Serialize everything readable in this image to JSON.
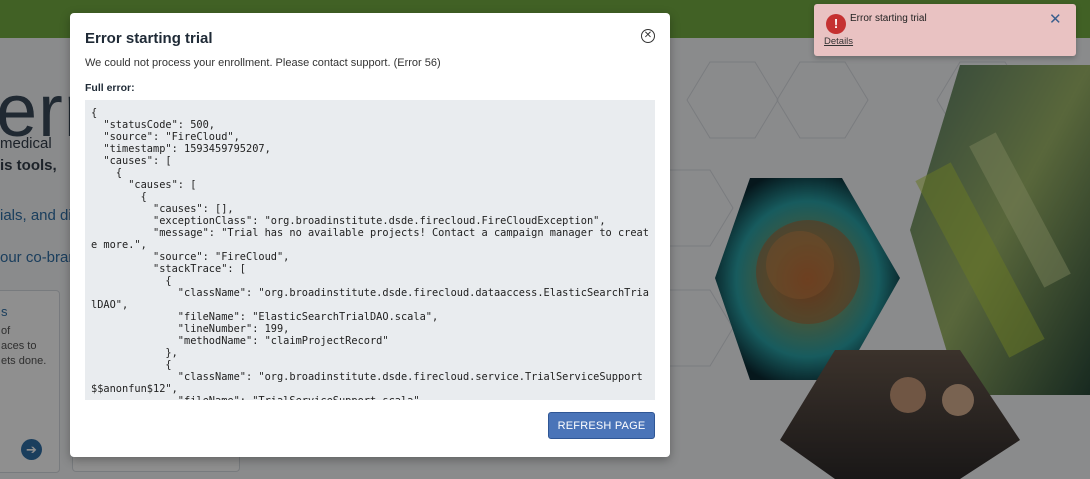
{
  "background": {
    "hero_title": "erra",
    "hero_lines": [
      "medical",
      "is tools,",
      "ials, and di",
      "our co-bran"
    ],
    "card": {
      "title": "s",
      "description": "of\naces to\nets done."
    }
  },
  "modal": {
    "title": "Error starting trial",
    "message": "We could not process your enrollment. Please contact support. (Error 56)",
    "full_error_label": "Full error:",
    "full_error_text": "{\n  \"statusCode\": 500,\n  \"source\": \"FireCloud\",\n  \"timestamp\": 1593459795207,\n  \"causes\": [\n    {\n      \"causes\": [\n        {\n          \"causes\": [],\n          \"exceptionClass\": \"org.broadinstitute.dsde.firecloud.FireCloudException\",\n          \"message\": \"Trial has no available projects! Contact a campaign manager to create more.\",\n          \"source\": \"FireCloud\",\n          \"stackTrace\": [\n            {\n              \"className\": \"org.broadinstitute.dsde.firecloud.dataaccess.ElasticSearchTrialDAO\",\n              \"fileName\": \"ElasticSearchTrialDAO.scala\",\n              \"lineNumber\": 199,\n              \"methodName\": \"claimProjectRecord\"\n            },\n            {\n              \"className\": \"org.broadinstitute.dsde.firecloud.service.TrialServiceSupport$$anonfun$12\",\n              \"fileName\": \"TrialServiceSupport.scala\",",
    "refresh_label": "REFRESH PAGE",
    "close_icon": "close-circle-icon"
  },
  "toast": {
    "title": "Error starting trial",
    "details_label": "Details",
    "error_icon": "exclamation-icon",
    "close_icon": "close-icon"
  },
  "colors": {
    "topbar": "#74ae43",
    "primary_button": "#4a74b8",
    "toast_bg": "#e9c2c2",
    "error_icon": "#c53131",
    "code_bg": "#e9ecef"
  }
}
